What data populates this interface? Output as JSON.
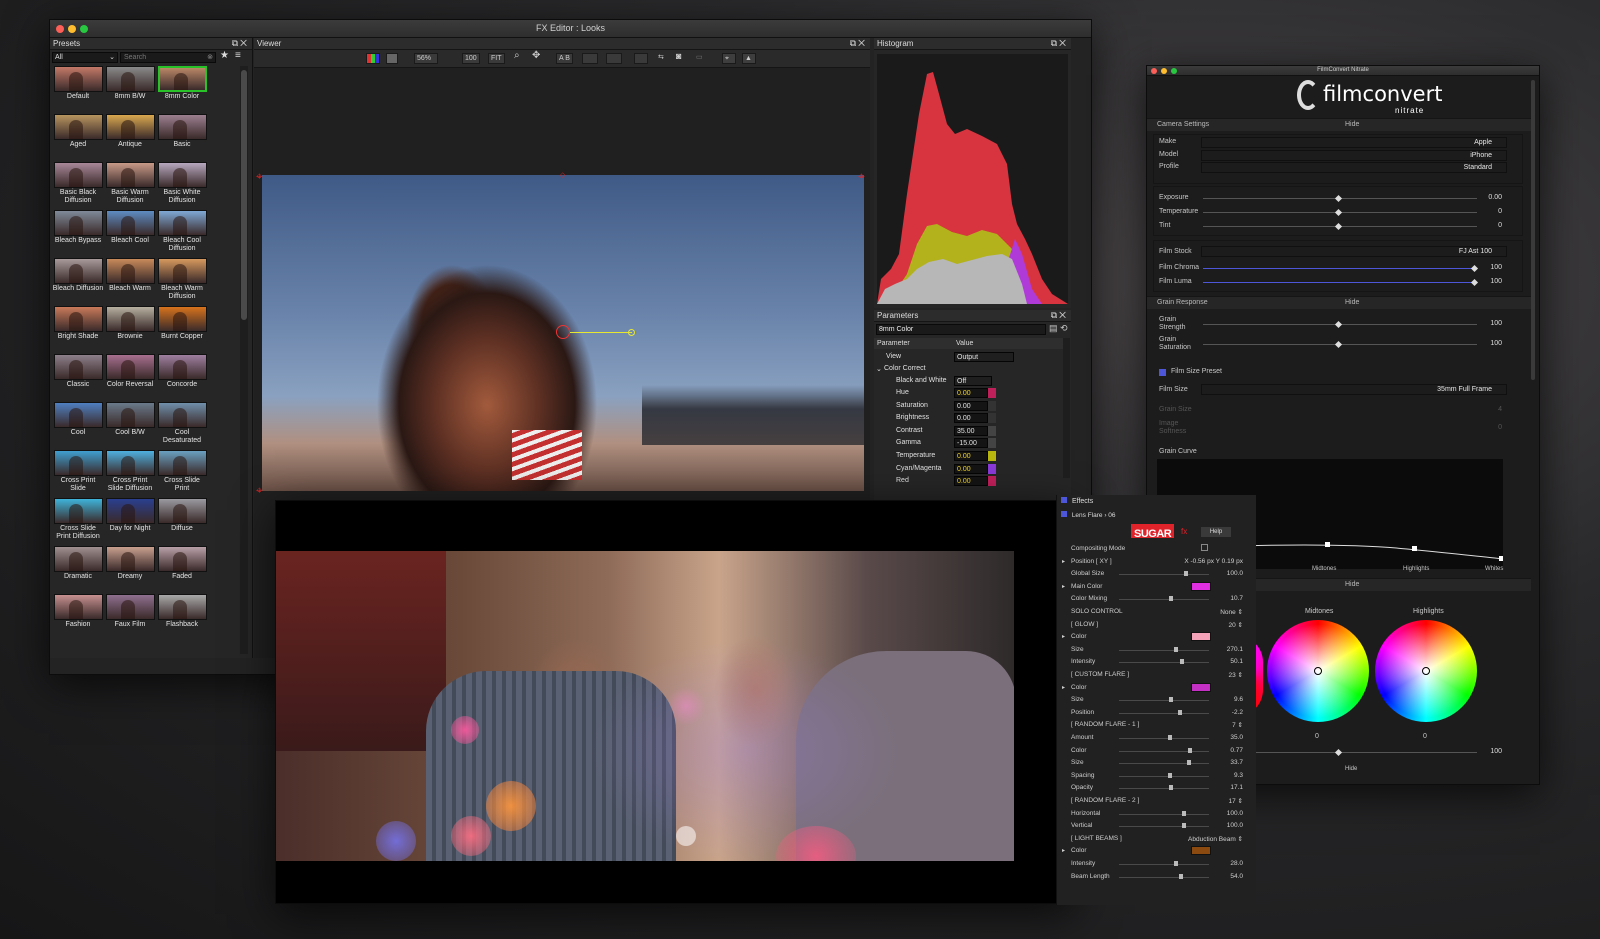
{
  "fx_editor": {
    "title": "FX Editor : Looks",
    "presets_panel": {
      "title": "Presets",
      "filter": "All",
      "search_placeholder": "Search",
      "items": [
        {
          "label": "Default",
          "color": "#c47968",
          "selected": false
        },
        {
          "label": "8mm B/W",
          "color": "#8a8a8a",
          "selected": false
        },
        {
          "label": "8mm Color",
          "color": "#b98767",
          "selected": true
        },
        {
          "label": "Aged",
          "color": "#b8955f",
          "selected": false
        },
        {
          "label": "Antique",
          "color": "#d9a84f",
          "selected": false
        },
        {
          "label": "Basic",
          "color": "#9c7f8f",
          "selected": false
        },
        {
          "label": "Basic Black Diffusion",
          "color": "#a88898",
          "selected": false
        },
        {
          "label": "Basic Warm Diffusion",
          "color": "#c89a88",
          "selected": false
        },
        {
          "label": "Basic White Diffusion",
          "color": "#b7a8bf",
          "selected": false
        },
        {
          "label": "Bleach Bypass",
          "color": "#7f8a99",
          "selected": false
        },
        {
          "label": "Bleach Cool",
          "color": "#5e8cc2",
          "selected": false
        },
        {
          "label": "Bleach Cool Diffusion",
          "color": "#7fa9d6",
          "selected": false
        },
        {
          "label": "Bleach Diffusion",
          "color": "#a89a9a",
          "selected": false
        },
        {
          "label": "Bleach Warm",
          "color": "#c88a5a",
          "selected": false
        },
        {
          "label": "Bleach Warm Diffusion",
          "color": "#d6995e",
          "selected": false
        },
        {
          "label": "Bright Shade",
          "color": "#c97a5a",
          "selected": false
        },
        {
          "label": "Brownie",
          "color": "#b7b0a0",
          "selected": false
        },
        {
          "label": "Burnt Copper",
          "color": "#d6721c",
          "selected": false
        },
        {
          "label": "Classic",
          "color": "#8d7f8a",
          "selected": false
        },
        {
          "label": "Color Reversal",
          "color": "#a86f8f",
          "selected": false
        },
        {
          "label": "Concorde",
          "color": "#9f7fa0",
          "selected": false
        },
        {
          "label": "Cool",
          "color": "#4f7fc0",
          "selected": false
        },
        {
          "label": "Cool B/W",
          "color": "#6a7a8a",
          "selected": false
        },
        {
          "label": "Cool Desaturated",
          "color": "#6f8faa",
          "selected": false
        },
        {
          "label": "Cross Print Slide",
          "color": "#3f9fd0",
          "selected": false
        },
        {
          "label": "Cross Print Slide Diffusion",
          "color": "#4fb0df",
          "selected": false
        },
        {
          "label": "Cross Slide Print",
          "color": "#6aa0c0",
          "selected": false
        },
        {
          "label": "Cross Slide Print Diffusion",
          "color": "#3fb3d9",
          "selected": false
        },
        {
          "label": "Day for Night",
          "color": "#2a3f8f",
          "selected": false
        },
        {
          "label": "Diffuse",
          "color": "#9a9aa0",
          "selected": false
        },
        {
          "label": "Dramatic",
          "color": "#a09090",
          "selected": false
        },
        {
          "label": "Dreamy",
          "color": "#c9a08f",
          "selected": false
        },
        {
          "label": "Faded",
          "color": "#b9a0a8",
          "selected": false
        },
        {
          "label": "Fashion",
          "color": "#c79090",
          "selected": false
        },
        {
          "label": "Faux Film",
          "color": "#8f6f8f",
          "selected": false
        },
        {
          "label": "Flashback",
          "color": "#a9a9a9",
          "selected": false
        }
      ]
    },
    "viewer": {
      "title": "Viewer",
      "zoom": "56%",
      "btn_100": "100",
      "btn_fit": "FIT",
      "btn_ab": "A B"
    },
    "histogram": {
      "title": "Histogram"
    },
    "parameters": {
      "title": "Parameters",
      "preset_name": "8mm Color",
      "col_param": "Parameter",
      "col_value": "Value",
      "view_label": "View",
      "view_value": "Output",
      "group": "Color Correct",
      "bw_label": "Black and White",
      "bw_value": "Off",
      "rows": [
        {
          "name": "Hue",
          "value": "0.00",
          "highlight": true
        },
        {
          "name": "Saturation",
          "value": "0.00",
          "highlight": false
        },
        {
          "name": "Brightness",
          "value": "0.00",
          "highlight": false
        },
        {
          "name": "Contrast",
          "value": "35.00",
          "highlight": false
        },
        {
          "name": "Gamma",
          "value": "-15.00",
          "highlight": false
        },
        {
          "name": "Temperature",
          "value": "0.00",
          "highlight": true
        },
        {
          "name": "Cyan/Magenta",
          "value": "0.00",
          "highlight": true
        },
        {
          "name": "Red",
          "value": "0.00",
          "highlight": true
        }
      ]
    }
  },
  "filmconvert": {
    "window_title": "FilmConvert Nitrate",
    "logo_text": "filmconvert",
    "logo_sub": "nitrate",
    "camera_settings": "Camera Settings",
    "hide": "Hide",
    "make_label": "Make",
    "make_value": "Apple",
    "model_label": "Model",
    "model_value": "iPhone",
    "profile_label": "Profile",
    "profile_value": "Standard",
    "exposure_label": "Exposure",
    "exposure_value": "0.00",
    "temperature_label": "Temperature",
    "temperature_value": "0",
    "tint_label": "Tint",
    "tint_value": "0",
    "film_stock_label": "Film Stock",
    "film_stock_value": "FJ Ast 100",
    "film_chroma_label": "Film Chroma",
    "film_chroma_value": "100",
    "film_luma_label": "Film Luma",
    "film_luma_value": "100",
    "grain_response": "Grain Response",
    "grain_strength_label": "Grain Strength",
    "grain_strength_value": "100",
    "grain_saturation_label": "Grain Saturation",
    "grain_saturation_value": "100",
    "film_size_preset": "Film Size Preset",
    "film_size_label": "Film Size",
    "film_size_value": "35mm Full Frame",
    "grain_size_label": "Grain Size",
    "grain_size_value": "4",
    "image_softness_label": "Image Softness",
    "image_softness_value": "0",
    "grain_curve": "Grain Curve",
    "curve_labels": [
      "Midtones",
      "Highlights",
      "Whites"
    ],
    "wheel_midtones": "Midtones",
    "wheel_highlights": "Highlights",
    "wheel_midtones_value": "0",
    "wheel_highlights_value": "0",
    "bottom_value": "100",
    "hide_bottom": "Hide"
  },
  "sugarfx": {
    "effects": "Effects",
    "lens_flare": "Lens Flare › 06",
    "brand": "SUGAR",
    "brand_fx": "fx",
    "help": "Help",
    "rows": [
      {
        "name": "Compositing Mode",
        "value": "",
        "type": "check"
      },
      {
        "name": "Position [ XY ]",
        "value": "X   -0.56 px    Y    0.19 px",
        "type": "xy",
        "tri": true
      },
      {
        "name": "Global Size",
        "value": "100.0",
        "type": "slider",
        "k": 0.9
      },
      {
        "name": "Main Color",
        "value": "",
        "type": "swatch",
        "color": "#e02fe0",
        "tri": true
      },
      {
        "name": "Color Mixing",
        "value": "10.7",
        "type": "slider",
        "k": 0.7
      },
      {
        "name": "SOLO CONTROL",
        "value": "None ⇕",
        "type": "text"
      },
      {
        "name": "[  GLOW  ]",
        "value": "20 ⇕",
        "type": "text"
      },
      {
        "name": "Color",
        "value": "",
        "type": "swatch",
        "color": "#f3a2b8",
        "tri": true
      },
      {
        "name": "Size",
        "value": "270.1",
        "type": "slider",
        "k": 0.77
      },
      {
        "name": "Intensity",
        "value": "50.1",
        "type": "slider",
        "k": 0.85
      },
      {
        "name": "[  CUSTOM FLARE  ]",
        "value": "23 ⇕",
        "type": "text"
      },
      {
        "name": "Color",
        "value": "",
        "type": "swatch",
        "color": "#c42fc4",
        "tri": true
      },
      {
        "name": "Size",
        "value": "9.6",
        "type": "slider",
        "k": 0.7
      },
      {
        "name": "Position",
        "value": "-2.2",
        "type": "slider",
        "k": 0.82
      },
      {
        "name": "[  RANDOM FLARE - 1  ]",
        "value": "7 ⇕",
        "type": "text"
      },
      {
        "name": "Amount",
        "value": "35.0",
        "type": "slider",
        "k": 0.68
      },
      {
        "name": "Color",
        "value": "0.77",
        "type": "slider",
        "k": 0.96
      },
      {
        "name": "Size",
        "value": "33.7",
        "type": "slider",
        "k": 0.94
      },
      {
        "name": "Spacing",
        "value": "9.3",
        "type": "slider",
        "k": 0.68
      },
      {
        "name": "Opacity",
        "value": "17.1",
        "type": "slider",
        "k": 0.7
      },
      {
        "name": "[  RANDOM FLARE - 2  ]",
        "value": "17 ⇕",
        "type": "text"
      },
      {
        "name": "Horizontal",
        "value": "100.0",
        "type": "slider",
        "k": 0.88
      },
      {
        "name": "Vertical",
        "value": "100.0",
        "type": "slider",
        "k": 0.88
      },
      {
        "name": "[  LIGHT BEAMS  ]",
        "value": "Abduction Beam ⇕",
        "type": "text"
      },
      {
        "name": "Color",
        "value": "",
        "type": "swatch",
        "color": "#8a4a10",
        "tri": true
      },
      {
        "name": "Intensity",
        "value": "28.0",
        "type": "slider",
        "k": 0.76
      },
      {
        "name": "Beam Length",
        "value": "54.0",
        "type": "slider",
        "k": 0.84
      }
    ]
  }
}
